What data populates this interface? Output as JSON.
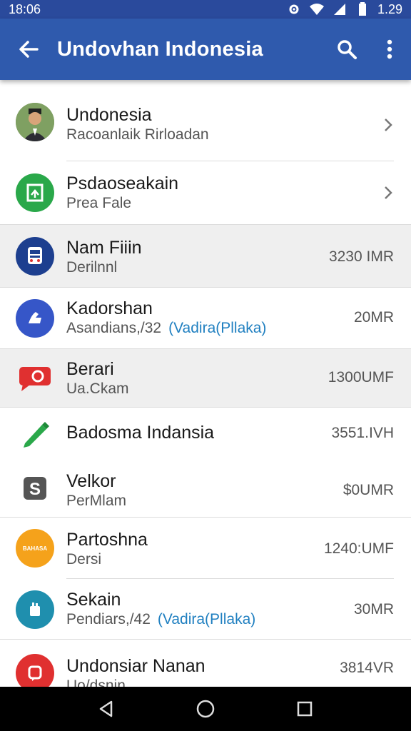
{
  "status_bar": {
    "time": "18:06",
    "battery_time": "1.29"
  },
  "app_bar": {
    "title": "Undovhan Indonesia",
    "back_icon": "arrow-back-icon",
    "search_icon": "search-icon",
    "more_icon": "more-vert-icon"
  },
  "colors": {
    "app_bar": "#2f5aad",
    "status_bar": "#2a4a9c",
    "link": "#1f7fc0"
  },
  "items": [
    {
      "title": "Undonesia",
      "subtitle": "Racoanlaik Rirloadan",
      "icon": "person-avatar"
    },
    {
      "title": "Psdaoseakain",
      "subtitle": "Prea Fale",
      "icon": "green-doc-icon"
    },
    {
      "title": "Nam Fiiin",
      "subtitle": "Derilnnl",
      "value": "3230 IMR",
      "icon": "bus-icon"
    },
    {
      "title": "Kadorshan",
      "subtitle": "Asandians,/32",
      "link": "(Vadira(Pllaka)",
      "value": "20MR",
      "icon": "hand-icon"
    },
    {
      "title": "Berari",
      "subtitle": "Ua.Ckam",
      "value": "1300UMF",
      "icon": "chat-bubble-icon"
    },
    {
      "title": "Badosma Indansia",
      "value": "3551.IVH",
      "icon": "pencil-icon"
    },
    {
      "title": "Velkor",
      "subtitle": "PerMlam",
      "value": "$0UMR",
      "icon": "dollar-icon"
    },
    {
      "title": "Partoshna",
      "subtitle": "Dersi",
      "value": "1240:UMF",
      "icon": "orange-badge-icon",
      "badge_text": "BAHASA"
    },
    {
      "title": "Sekain",
      "subtitle": "Pendiars,/42",
      "link": "(Vadira(Pllaka)",
      "value": "30MR",
      "icon": "teal-hand-icon"
    },
    {
      "title": "Undonsiar Nanan",
      "subtitle": "Uo/dsnin",
      "value": "3814VR",
      "icon": "red-square-icon"
    }
  ]
}
